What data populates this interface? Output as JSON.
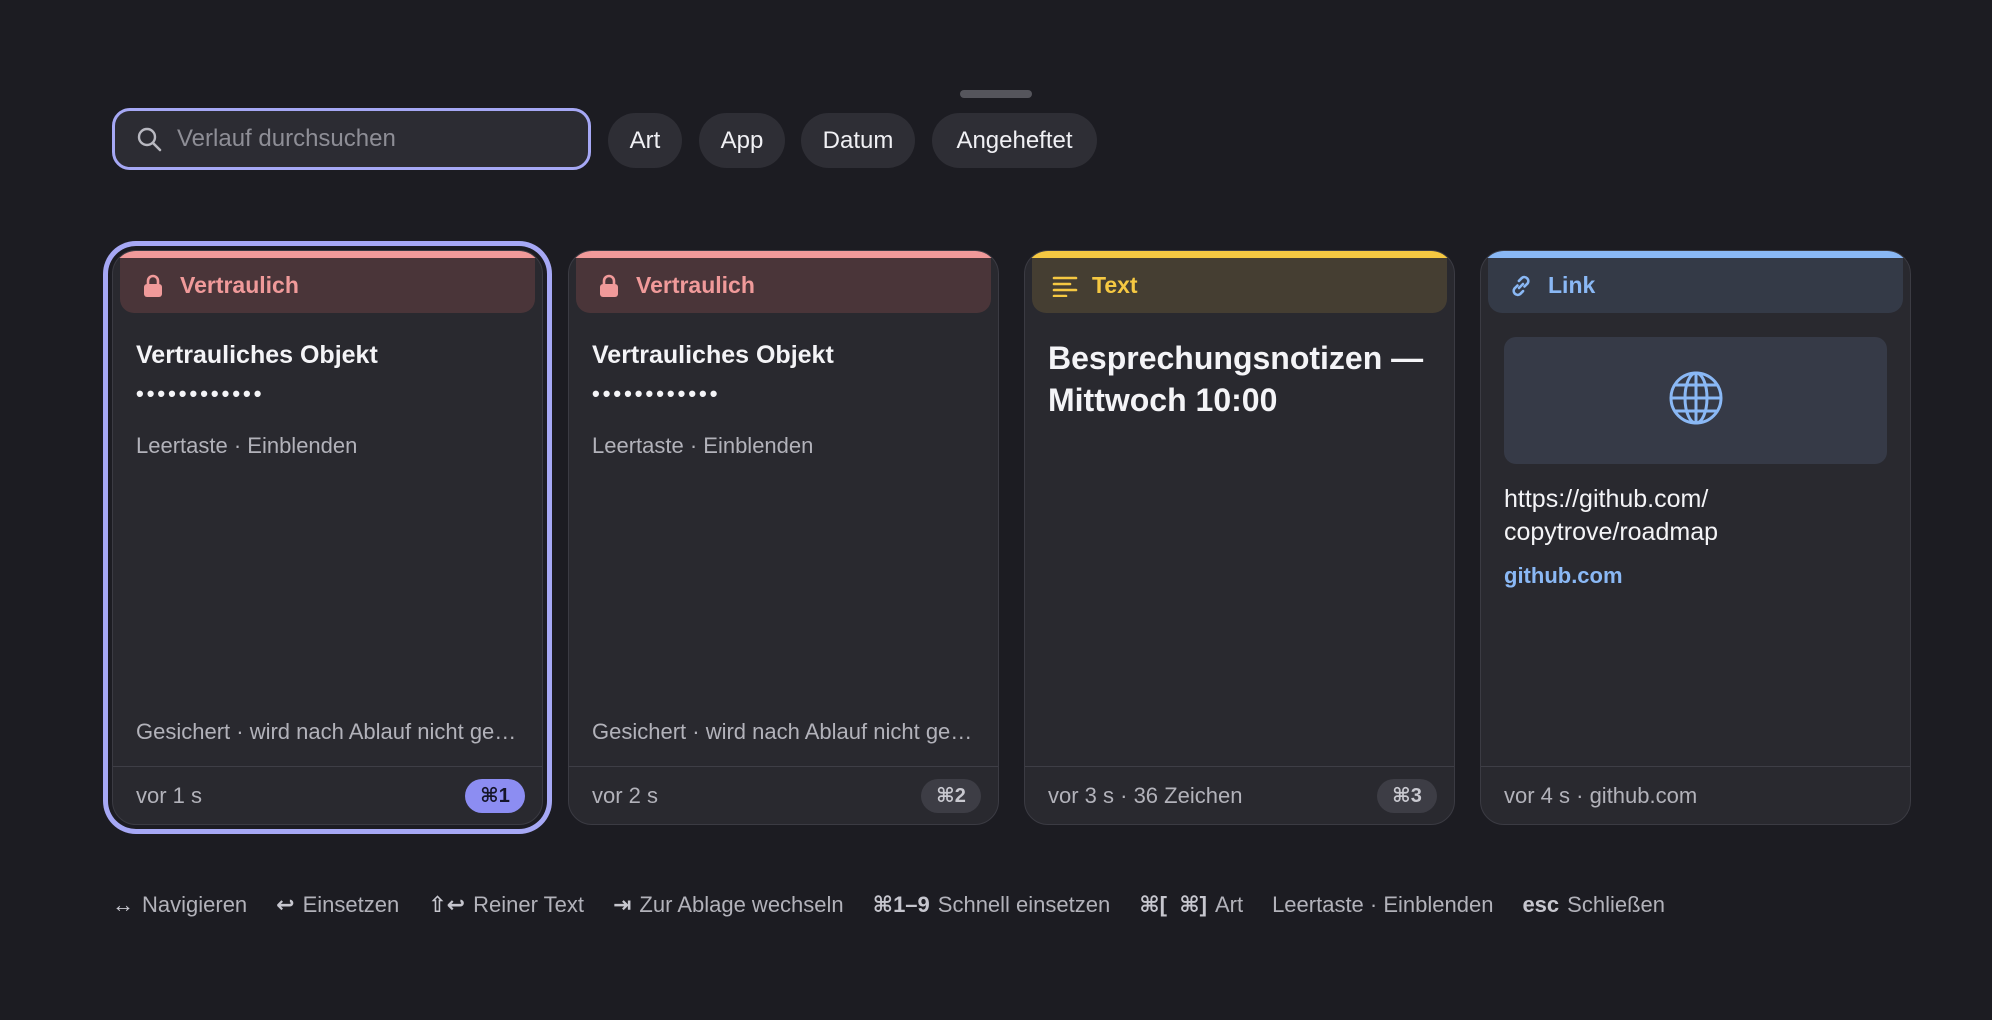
{
  "search": {
    "placeholder": "Verlauf durchsuchen",
    "value": ""
  },
  "filters": [
    "Art",
    "App",
    "Datum",
    "Angeheftet"
  ],
  "colors": {
    "accent": "#a6a8f5",
    "sensitive": "#f09a9a",
    "text_kind": "#f5c842",
    "link_kind": "#8ab8f5"
  },
  "cards": [
    {
      "kind": "Vertraulich",
      "icon": "lock-icon",
      "title": "Vertrauliches Objekt",
      "mask": "••••••••••••",
      "hint": "Leertaste · Einblenden",
      "secured": "Gesichert · wird nach Ablauf nicht gespeichert",
      "meta": "vor 1 s",
      "shortcut": "⌘1"
    },
    {
      "kind": "Vertraulich",
      "icon": "lock-icon",
      "title": "Vertrauliches Objekt",
      "mask": "••••••••••••",
      "hint": "Leertaste · Einblenden",
      "secured": "Gesichert · wird nach Ablauf nicht gespeichert",
      "meta": "vor 2 s",
      "shortcut": "⌘2"
    },
    {
      "kind": "Text",
      "icon": "text-lines-icon",
      "content": "Besprechungsnotizen — Mittwoch 10:00",
      "meta": "vor 3 s · 36 Zeichen",
      "shortcut": "⌘3"
    },
    {
      "kind": "Link",
      "icon": "link-icon",
      "url": "https://github.com/ copytrove/roadmap",
      "domain": "github.com",
      "meta": "vor 4 s · github.com"
    }
  ],
  "hints": [
    {
      "key": "↔",
      "label": "Navigieren"
    },
    {
      "key": "↩",
      "label": "Einsetzen"
    },
    {
      "key": "⇧↩",
      "label": "Reiner Text"
    },
    {
      "key": "⇥",
      "label": "Zur Ablage wechseln"
    },
    {
      "key": "⌘1–9",
      "label": "Schnell einsetzen"
    },
    {
      "key": "⌘[  ⌘]",
      "label": "Art"
    },
    {
      "key": "",
      "label": "Leertaste · Einblenden"
    },
    {
      "key": "esc",
      "label": "Schließen"
    }
  ]
}
